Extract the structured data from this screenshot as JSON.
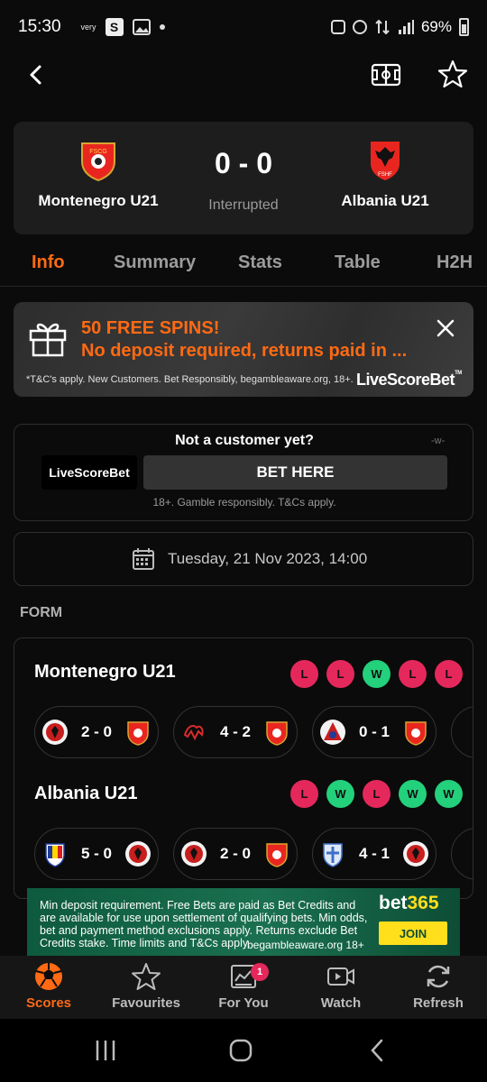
{
  "status_bar": {
    "time": "15:30",
    "mini_label": "very",
    "s_label": "S",
    "battery": "69%"
  },
  "match": {
    "home": {
      "name": "Montenegro U21",
      "crest_text": "FSCG"
    },
    "away": {
      "name": "Albania U21",
      "crest_text": "FSHF"
    },
    "score": "0 - 0",
    "status": "Interrupted"
  },
  "tabs": [
    "Info",
    "Summary",
    "Stats",
    "Table",
    "H2H"
  ],
  "promo": {
    "title": "50 FREE SPINS!",
    "subtitle": "No deposit required, returns paid in ...",
    "fine_print": "*T&C's apply. New Customers. Bet Responsibly, begambleaware.org, 18+.",
    "brand": "LiveScoreBet",
    "brand_tm": "TM"
  },
  "customer": {
    "title": "Not a customer yet?",
    "tag": "-w-",
    "logo": "LiveScoreBet",
    "button": "BET HERE",
    "fine_print": "18+. Gamble responsibly. T&Cs apply."
  },
  "kickoff": "Tuesday, 21 Nov 2023, 14:00",
  "form": {
    "label": "FORM",
    "teams": [
      {
        "name": "Montenegro U21",
        "results": [
          "L",
          "L",
          "W",
          "L",
          "L"
        ],
        "matches": [
          "2 - 0",
          "4 - 2",
          "0 - 1"
        ]
      },
      {
        "name": "Albania U21",
        "results": [
          "L",
          "W",
          "L",
          "W",
          "W"
        ],
        "matches": [
          "5 - 0",
          "2 - 0",
          "4 - 1"
        ]
      }
    ]
  },
  "ad": {
    "text": "Min deposit requirement. Free Bets are paid as Bet Credits and are available for use upon settlement of qualifying bets. Min odds, bet and payment method exclusions apply. Returns exclude Bet Credits stake. Time limits and T&Cs apply.",
    "footer": "begambleaware.org  18+",
    "brand_a": "bet",
    "brand_b": "365",
    "cta": "JOIN"
  },
  "bottom_nav": [
    {
      "label": "Scores",
      "icon": "soccer-ball-icon"
    },
    {
      "label": "Favourites",
      "icon": "star-icon"
    },
    {
      "label": "For You",
      "icon": "news-icon",
      "badge": "1"
    },
    {
      "label": "Watch",
      "icon": "video-icon"
    },
    {
      "label": "Refresh",
      "icon": "refresh-icon"
    }
  ],
  "colors": {
    "accent": "#ff6a13",
    "loss": "#e5285c",
    "win": "#23d07b",
    "card": "#1d1d1d"
  }
}
